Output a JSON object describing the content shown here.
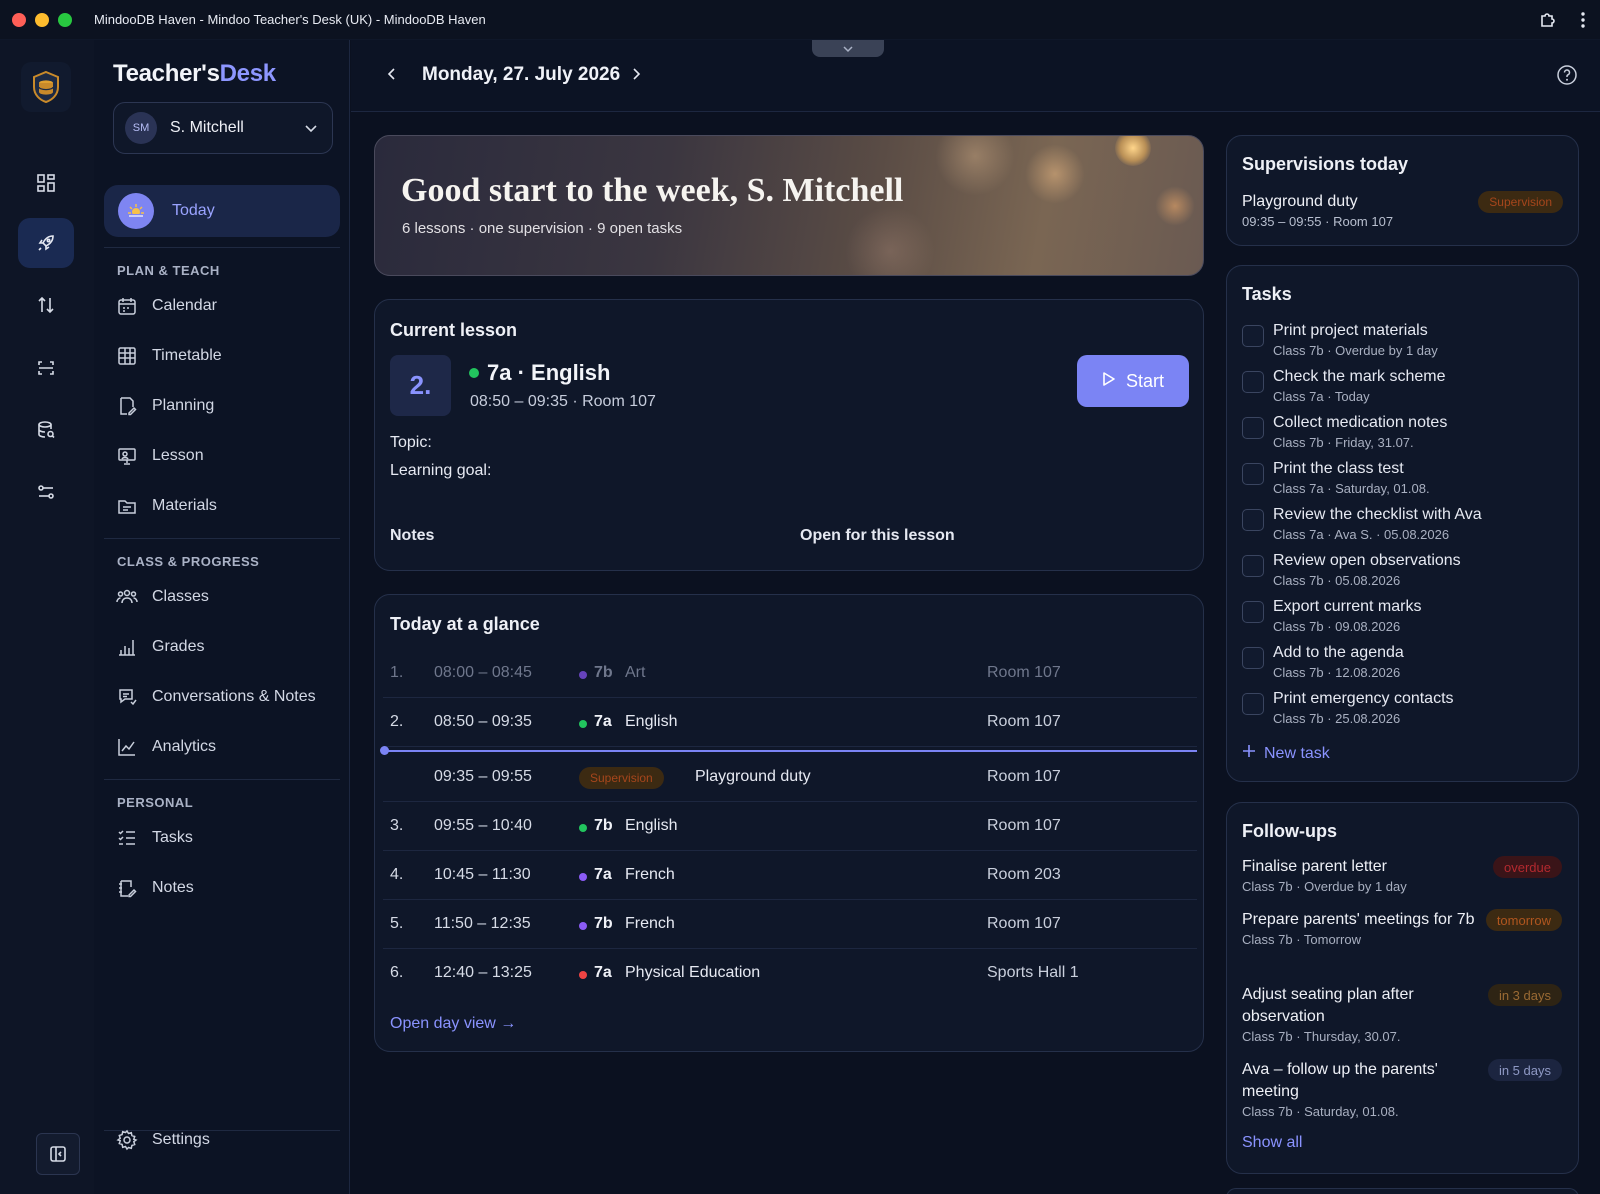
{
  "window": {
    "title": "MindooDB Haven - Mindoo Teacher's Desk (UK) - MindooDB Haven"
  },
  "brand": {
    "part1": "Teacher's",
    "part2": "Desk"
  },
  "user": {
    "initials": "SM",
    "name": "S. Mitchell"
  },
  "sidebar": {
    "today_label": "Today",
    "sections": [
      {
        "title": "PLAN & TEACH",
        "items": [
          "Calendar",
          "Timetable",
          "Planning",
          "Lesson",
          "Materials"
        ]
      },
      {
        "title": "CLASS & PROGRESS",
        "items": [
          "Classes",
          "Grades",
          "Conversations & Notes",
          "Analytics"
        ]
      },
      {
        "title": "PERSONAL",
        "items": [
          "Tasks",
          "Notes"
        ]
      }
    ],
    "settings_label": "Settings"
  },
  "header": {
    "date": "Monday, 27. July 2026"
  },
  "hero": {
    "title": "Good start to the week, S. Mitchell",
    "subtitle": "6 lessons · one supervision · 9 open tasks"
  },
  "current_lesson": {
    "title": "Current lesson",
    "number": "2.",
    "name": "7a · English",
    "time_room": "08:50 – 09:35 · Room 107",
    "start_label": "Start",
    "topic_label": "Topic:",
    "goal_label": "Learning goal:",
    "notes_label": "Notes",
    "notes_link": "Open for this lesson"
  },
  "glance": {
    "title": "Today at a glance",
    "rows": [
      {
        "num": "1.",
        "time": "08:00 – 08:45",
        "cls": "7b",
        "subject": "Art",
        "room": "Room 107",
        "dot": "#8b5cf6"
      },
      {
        "num": "2.",
        "time": "08:50 – 09:35",
        "cls": "7a",
        "subject": "English",
        "room": "Room 107",
        "dot": "#22c55e"
      },
      {
        "num": "",
        "time": "09:35 – 09:55",
        "badge": "Supervision",
        "subject": "Playground duty",
        "room": "Room 107"
      },
      {
        "num": "3.",
        "time": "09:55 – 10:40",
        "cls": "7b",
        "subject": "English",
        "room": "Room 107",
        "dot": "#22c55e"
      },
      {
        "num": "4.",
        "time": "10:45 – 11:30",
        "cls": "7a",
        "subject": "French",
        "room": "Room 203",
        "dot": "#8b5cf6"
      },
      {
        "num": "5.",
        "time": "11:50 – 12:35",
        "cls": "7b",
        "subject": "French",
        "room": "Room 107",
        "dot": "#8b5cf6"
      },
      {
        "num": "6.",
        "time": "12:40 – 13:25",
        "cls": "7a",
        "subject": "Physical Education",
        "room": "Sports Hall 1",
        "dot": "#ef4444"
      }
    ],
    "open_day": "Open day view →"
  },
  "supervisions": {
    "title": "Supervisions today",
    "name": "Playground duty",
    "detail": "09:35 – 09:55 · Room 107",
    "badge": "Supervision"
  },
  "tasks": {
    "title": "Tasks",
    "items": [
      {
        "title": "Print project materials",
        "sub": "Class 7b · Overdue by 1 day"
      },
      {
        "title": "Check the mark scheme",
        "sub": "Class 7a · Today"
      },
      {
        "title": "Collect medication notes",
        "sub": "Class 7b · Friday, 31.07."
      },
      {
        "title": "Print the class test",
        "sub": "Class 7a · Saturday, 01.08."
      },
      {
        "title": "Review the checklist with Ava",
        "sub": "Class 7a · Ava S. · 05.08.2026"
      },
      {
        "title": "Review open observations",
        "sub": "Class 7b · 05.08.2026"
      },
      {
        "title": "Export current marks",
        "sub": "Class 7b · 09.08.2026"
      },
      {
        "title": "Add to the agenda",
        "sub": "Class 7b · 12.08.2026"
      },
      {
        "title": "Print emergency contacts",
        "sub": "Class 7b · 25.08.2026"
      }
    ],
    "new_task": "New task"
  },
  "followups": {
    "title": "Follow-ups",
    "items": [
      {
        "title": "Finalise parent letter",
        "sub": "Class 7b · Overdue by 1 day",
        "badge": "overdue"
      },
      {
        "title": "Prepare parents' meetings for 7b",
        "sub": "Class 7b · Tomorrow",
        "badge": "tomorrow"
      },
      {
        "title": "Adjust seating plan after observation",
        "sub": "Class 7b · Thursday, 30.07.",
        "badge": "in 3 days"
      },
      {
        "title": "Ava – follow up the parents' meeting",
        "sub": "Class 7b · Saturday, 01.08.",
        "badge": "in 5 days"
      }
    ],
    "show_all": "Show all"
  }
}
